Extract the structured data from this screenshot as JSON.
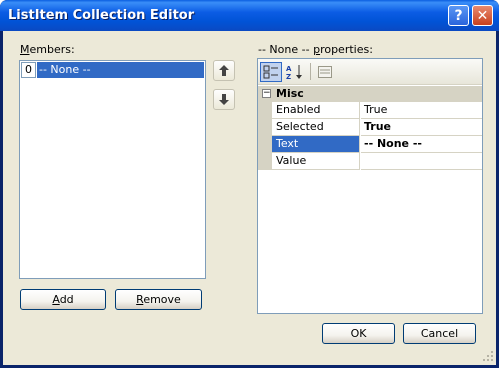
{
  "window": {
    "title": "ListItem Collection Editor",
    "help_glyph": "?",
    "close_glyph": "✕"
  },
  "members": {
    "label_prefix": "",
    "label_underlined": "M",
    "label_rest": "embers:",
    "items": [
      {
        "index": "0",
        "text": "-- None --",
        "selected": true
      }
    ]
  },
  "arrows": {
    "up_glyph": "🡅",
    "down_glyph": "🡇"
  },
  "buttons": {
    "add_u": "A",
    "add_rest": "dd",
    "remove_u": "R",
    "remove_rest": "emove",
    "ok": "OK",
    "cancel": "Cancel"
  },
  "properties": {
    "label_prefix": "-- None -- ",
    "label_underlined": "p",
    "label_rest": "roperties:",
    "toolbar": {
      "categorized_glyph": "▦",
      "alpha_glyph": "A↓",
      "pages_glyph": "▤"
    },
    "category": {
      "expander": "−",
      "name": "Misc"
    },
    "rows": [
      {
        "name": "Enabled",
        "value": "True",
        "bold": false,
        "selected": false
      },
      {
        "name": "Selected",
        "value": "True",
        "bold": true,
        "selected": false
      },
      {
        "name": "Text",
        "value": "-- None --",
        "bold": true,
        "selected": true
      },
      {
        "name": "Value",
        "value": "",
        "bold": false,
        "selected": false
      }
    ]
  },
  "colors": {
    "titlebar": "#0153d6",
    "client": "#ece9d8",
    "selection": "#316ac5"
  }
}
